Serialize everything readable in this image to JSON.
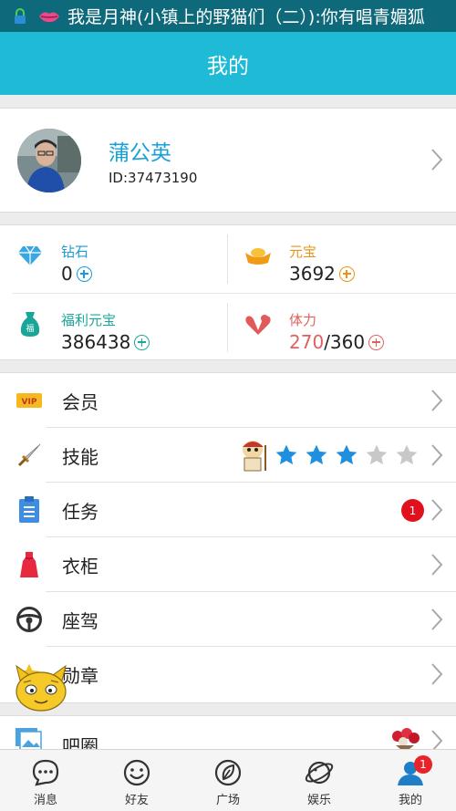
{
  "status_bar": {
    "notification_text": "我是月神(小镇上的野猫们（二）):你有唱青媚狐"
  },
  "header": {
    "title": "我的"
  },
  "profile": {
    "name": "蒲公英",
    "id_text": "ID:37473190"
  },
  "assets": [
    {
      "label": "钻石",
      "value": "0",
      "label_color": "#1a9bd6",
      "icon": "diamond-icon"
    },
    {
      "label": "元宝",
      "value": "3692",
      "label_color": "#e8941a",
      "icon": "ingot-icon"
    },
    {
      "label": "福利元宝",
      "value": "386438",
      "label_color": "#1aa89a",
      "icon": "money-bag-icon"
    },
    {
      "label": "体力",
      "value_current": "270",
      "value_max": "/360",
      "label_color": "#e06060",
      "icon": "heart-arm-icon"
    }
  ],
  "menu": [
    {
      "label": "会员",
      "icon": "vip-icon"
    },
    {
      "label": "技能",
      "icon": "sword-icon",
      "stars_filled": 3,
      "stars_total": 5
    },
    {
      "label": "任务",
      "icon": "clipboard-icon",
      "badge": "1"
    },
    {
      "label": "衣柜",
      "icon": "dress-icon"
    },
    {
      "label": "座驾",
      "icon": "steering-wheel-icon"
    },
    {
      "label": "勋章",
      "icon": "star-medal-icon"
    }
  ],
  "menu2": {
    "label": "吧圈",
    "icon": "photo-icon"
  },
  "bottom_nav": [
    {
      "label": "消息",
      "icon": "chat-bubble-icon"
    },
    {
      "label": "好友",
      "icon": "smiley-icon"
    },
    {
      "label": "广场",
      "icon": "leaf-circle-icon"
    },
    {
      "label": "娱乐",
      "icon": "planet-icon"
    },
    {
      "label": "我的",
      "icon": "user-icon",
      "badge": "1",
      "active": true
    }
  ],
  "colors": {
    "header": "#1fbad6",
    "status_bar": "#0e6a7a",
    "name": "#1aa0d8",
    "badge": "#e0111d"
  }
}
